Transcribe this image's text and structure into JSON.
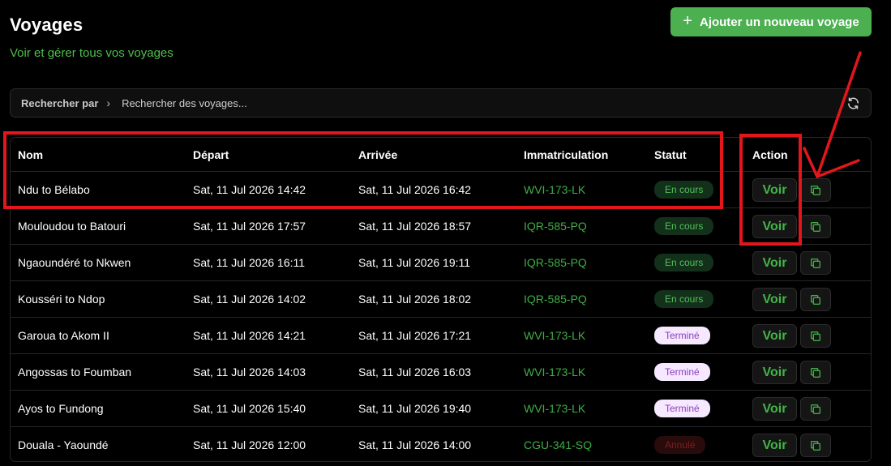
{
  "header": {
    "title": "Voyages",
    "subtitle": "Voir et gérer tous vos voyages",
    "add_button_label": "Ajouter un nouveau voyage"
  },
  "search": {
    "filter_label": "Rechercher par",
    "placeholder": "Rechercher des voyages..."
  },
  "table": {
    "columns": {
      "nom": "Nom",
      "depart": "Départ",
      "arrivee": "Arrivée",
      "immatriculation": "Immatriculation",
      "statut": "Statut",
      "action": "Action"
    },
    "view_label": "Voir",
    "rows": [
      {
        "nom": "Ndu to Bélabo",
        "depart": "Sat, 11 Jul 2026 14:42",
        "arrivee": "Sat, 11 Jul 2026 16:42",
        "immatriculation": "WVI-173-LK",
        "statut": "En cours",
        "statut_type": "encours"
      },
      {
        "nom": "Mouloudou to Batouri",
        "depart": "Sat, 11 Jul 2026 17:57",
        "arrivee": "Sat, 11 Jul 2026 18:57",
        "immatriculation": "IQR-585-PQ",
        "statut": "En cours",
        "statut_type": "encours"
      },
      {
        "nom": "Ngaoundéré to Nkwen",
        "depart": "Sat, 11 Jul 2026 16:11",
        "arrivee": "Sat, 11 Jul 2026 19:11",
        "immatriculation": "IQR-585-PQ",
        "statut": "En cours",
        "statut_type": "encours"
      },
      {
        "nom": "Kousséri to Ndop",
        "depart": "Sat, 11 Jul 2026 14:02",
        "arrivee": "Sat, 11 Jul 2026 18:02",
        "immatriculation": "IQR-585-PQ",
        "statut": "En cours",
        "statut_type": "encours"
      },
      {
        "nom": "Garoua to Akom II",
        "depart": "Sat, 11 Jul 2026 14:21",
        "arrivee": "Sat, 11 Jul 2026 17:21",
        "immatriculation": "WVI-173-LK",
        "statut": "Terminé",
        "statut_type": "termine"
      },
      {
        "nom": "Angossas to Foumban",
        "depart": "Sat, 11 Jul 2026 14:03",
        "arrivee": "Sat, 11 Jul 2026 16:03",
        "immatriculation": "WVI-173-LK",
        "statut": "Terminé",
        "statut_type": "termine"
      },
      {
        "nom": "Ayos to Fundong",
        "depart": "Sat, 11 Jul 2026 15:40",
        "arrivee": "Sat, 11 Jul 2026 19:40",
        "immatriculation": "WVI-173-LK",
        "statut": "Terminé",
        "statut_type": "termine"
      },
      {
        "nom": "Douala - Yaoundé",
        "depart": "Sat, 11 Jul 2026 12:00",
        "arrivee": "Sat, 11 Jul 2026 14:00",
        "immatriculation": "CGU-341-SQ",
        "statut": "Annulé",
        "statut_type": "annule"
      }
    ]
  },
  "icons": {
    "add": "plus-icon",
    "filter_chevron": "chevron-right-icon",
    "refresh": "refresh-icon",
    "copy": "copy-icon"
  },
  "colors": {
    "accent": "#4caf50",
    "annotation": "#e3161c"
  }
}
